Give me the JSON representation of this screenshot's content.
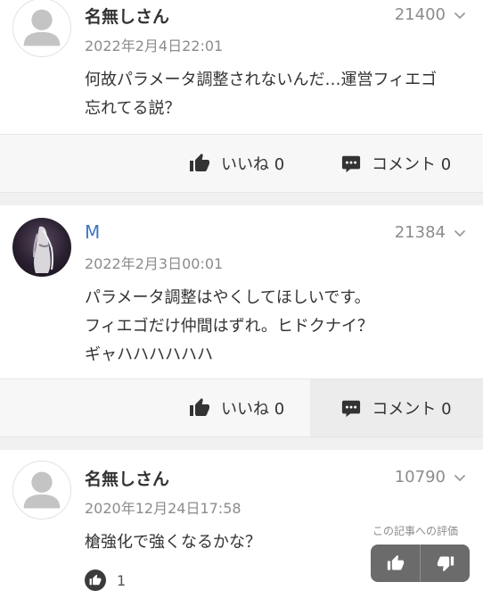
{
  "comments": [
    {
      "username": "名無しさん",
      "date": "2022年2月4日22:01",
      "number": "21400",
      "lines": [
        "何故パラメータ調整されないんだ…運営フィエゴ",
        "忘れてる説？"
      ],
      "like_label": "いいね 0",
      "comment_label": "コメント 0"
    },
    {
      "username": "M",
      "date": "2022年2月3日00:01",
      "number": "21384",
      "lines": [
        "パラメータ調整はやくしてほしいです。",
        "フィエゴだけ仲間はずれ。ヒドクナイ？",
        "ギャハハハハハハ"
      ],
      "like_label": "いいね 0",
      "comment_label": "コメント 0"
    },
    {
      "username": "名無しさん",
      "date": "2020年12月24日17:58",
      "number": "10790",
      "lines": [
        "槍強化で強くなるかな？"
      ],
      "like_count": "1"
    }
  ],
  "rating": {
    "label": "この記事への評価"
  },
  "icons": {
    "chevron": "chevron-down-icon",
    "avatar_default": "default-avatar-icon",
    "thumbs_up": "thumbs-up-icon",
    "thumbs_down": "thumbs-down-icon",
    "comment": "comment-bubble-icon"
  }
}
